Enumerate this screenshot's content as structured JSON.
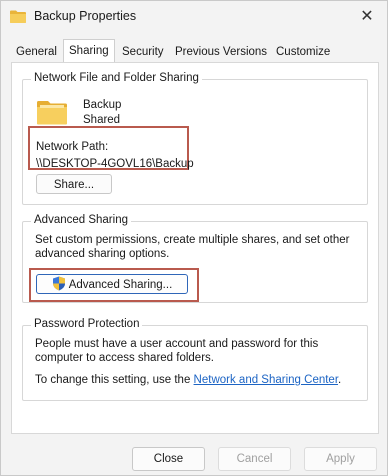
{
  "window": {
    "title": "Backup Properties",
    "close_glyph": "✕"
  },
  "tabs": [
    {
      "label": "General"
    },
    {
      "label": "Sharing"
    },
    {
      "label": "Security"
    },
    {
      "label": "Previous Versions"
    },
    {
      "label": "Customize"
    }
  ],
  "network_sharing": {
    "group_label": "Network File and Folder Sharing",
    "folder_name": "Backup",
    "folder_status": "Shared",
    "path_label": "Network Path:",
    "path_value": "\\\\DESKTOP-4GOVL16\\Backup",
    "share_button": "Share..."
  },
  "advanced_sharing": {
    "group_label": "Advanced Sharing",
    "description": "Set custom permissions, create multiple shares, and set other advanced sharing options.",
    "button_label": "Advanced Sharing..."
  },
  "password_protection": {
    "group_label": "Password Protection",
    "description": "People must have a user account and password for this computer to access shared folders.",
    "change_prefix": "To change this setting, use the ",
    "link_text": "Network and Sharing Center",
    "change_suffix": "."
  },
  "footer": {
    "close": "Close",
    "cancel": "Cancel",
    "apply": "Apply"
  },
  "colors": {
    "highlight": "#b95a4e",
    "link": "#1c64c4",
    "folder": "#f2c14e"
  }
}
